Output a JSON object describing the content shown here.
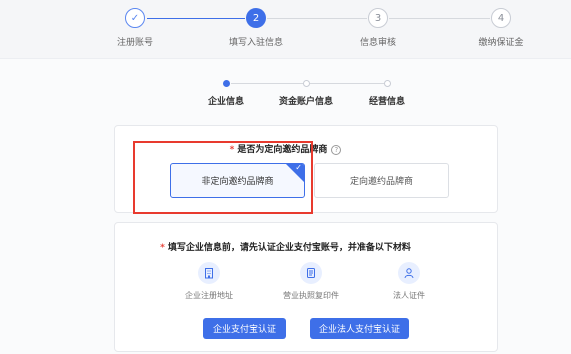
{
  "steps": [
    {
      "num": "✓",
      "label": "注册账号",
      "state": "done"
    },
    {
      "num": "2",
      "label": "填写入驻信息",
      "state": "active"
    },
    {
      "num": "3",
      "label": "信息审核",
      "state": "todo"
    },
    {
      "num": "4",
      "label": "缴纳保证金",
      "state": "todo"
    }
  ],
  "sub_steps": [
    {
      "label": "企业信息",
      "state": "active"
    },
    {
      "label": "资金账户信息",
      "state": "todo"
    },
    {
      "label": "经营信息",
      "state": "todo"
    }
  ],
  "brand_question": {
    "required_mark": "*",
    "text": "是否为定向邀约品牌商",
    "help": "?"
  },
  "options": [
    {
      "label": "非定向邀约品牌商",
      "selected": true
    },
    {
      "label": "定向邀约品牌商",
      "selected": false
    }
  ],
  "notice": {
    "required_mark": "*",
    "text": "填写企业信息前，请先认证企业支付宝账号，并准备以下材料"
  },
  "materials": [
    {
      "label": "企业注册地址",
      "icon": "building-icon"
    },
    {
      "label": "营业执照复印件",
      "icon": "document-icon"
    },
    {
      "label": "法人证件",
      "icon": "person-icon"
    }
  ],
  "buttons": {
    "enterprise_alipay": "企业支付宝认证",
    "legal_alipay": "企业法人支付宝认证"
  },
  "colors": {
    "primary": "#3e6fe8",
    "highlight": "#e83a2e",
    "required": "#e8453c"
  }
}
